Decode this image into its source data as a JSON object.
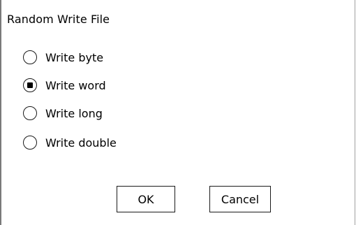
{
  "dialog": {
    "title": "Random Write File",
    "options": [
      {
        "label": "Write byte",
        "checked": false
      },
      {
        "label": "Write word",
        "checked": true
      },
      {
        "label": "Write long",
        "checked": false
      },
      {
        "label": "Write double",
        "checked": false
      }
    ],
    "buttons": {
      "ok_label": "OK",
      "cancel_label": "Cancel"
    }
  }
}
